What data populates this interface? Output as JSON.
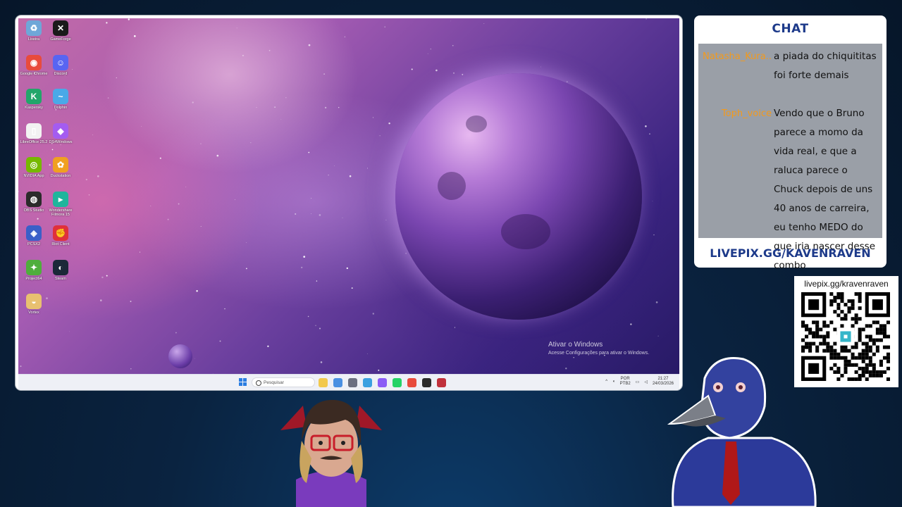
{
  "desktop": {
    "icons": [
      {
        "label": "Lixeira",
        "icon": "recycle-bin-icon",
        "color": "#6ea7d8"
      },
      {
        "label": "GameForge",
        "icon": "gameforge-icon",
        "color": "#1a1a1a"
      },
      {
        "label": "Google Chrome",
        "icon": "chrome-icon",
        "color": "#e84b3c"
      },
      {
        "label": "Discord",
        "icon": "discord-icon",
        "color": "#5865f2"
      },
      {
        "label": "Kaspersky",
        "icon": "kaspersky-icon",
        "color": "#22a66a"
      },
      {
        "label": "Dolphin",
        "icon": "dolphin-icon",
        "color": "#49a9e8"
      },
      {
        "label": "LibreOffice 25.2",
        "icon": "libreoffice-icon",
        "color": "#f2f2f2"
      },
      {
        "label": "DS4Windows",
        "icon": "ds4windows-icon",
        "color": "#a45cf0"
      },
      {
        "label": "NVIDIA App",
        "icon": "nvidia-icon",
        "color": "#76b900"
      },
      {
        "label": "Duckstation",
        "icon": "duckstation-icon",
        "color": "#f0a020"
      },
      {
        "label": "OBS Studio",
        "icon": "obs-icon",
        "color": "#2b2b2b"
      },
      {
        "label": "Wondershare Filmora 15",
        "icon": "filmora-icon",
        "color": "#1fb59c"
      },
      {
        "label": "PCSX2",
        "icon": "pcsx2-icon",
        "color": "#3a5fc8"
      },
      {
        "label": "Riot Client",
        "icon": "riot-icon",
        "color": "#e0303b"
      },
      {
        "label": "Project64",
        "icon": "project64-icon",
        "color": "#4fae3c"
      },
      {
        "label": "Steam",
        "icon": "steam-icon",
        "color": "#1b2838"
      },
      {
        "label": "Vortex",
        "icon": "vortex-icon",
        "color": "#e8c070"
      }
    ],
    "activation": {
      "title": "Ativar o Windows",
      "subtitle": "Acesse Configurações para ativar o Windows."
    }
  },
  "taskbar": {
    "search_placeholder": "Pesquisar",
    "pinned": [
      {
        "icon": "file-explorer-icon",
        "color": "#f2c94c"
      },
      {
        "icon": "widgets-icon",
        "color": "#4a90e2"
      },
      {
        "icon": "settings-icon",
        "color": "#6b6f80"
      },
      {
        "icon": "monitor-icon",
        "color": "#3aa0e0"
      },
      {
        "icon": "messenger-icon",
        "color": "#8b5cf6"
      },
      {
        "icon": "whatsapp-icon",
        "color": "#25d366"
      },
      {
        "icon": "chrome-icon",
        "color": "#e84b3c"
      },
      {
        "icon": "obs-icon",
        "color": "#2b2b2b"
      },
      {
        "icon": "riot-icon",
        "color": "#c0303b"
      }
    ],
    "tray": {
      "lang_line1": "POR",
      "lang_line2": "PTB2",
      "time": "21:27",
      "date": "24/03/2026"
    }
  },
  "chat": {
    "title": "CHAT",
    "messages": [
      {
        "user": "Natasha_Kura...",
        "text": "a piada do chiquititas foi forte demais"
      },
      {
        "user": "Toph_voice",
        "text": "Vendo que o Bruno parece a momo da vida real, e que a raluca parece o Chuck depois de uns 40 anos de carreira, eu tenho MEDO do que iria nascer desse combo"
      }
    ],
    "link": "LIVEPIX.GG/KAVENRAVEN"
  },
  "qr": {
    "label": "livepix.gg/kravenraven"
  },
  "colors": {
    "brand_blue": "#1d3a8a",
    "username_orange": "#f39a1c",
    "chat_bg": "#9a9fa7"
  }
}
